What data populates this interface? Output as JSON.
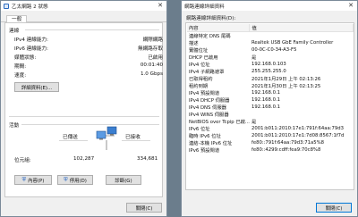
{
  "status_window": {
    "title": "乙太網路 2 狀態",
    "tab": "一般",
    "connection": {
      "heading": "連線",
      "rows": [
        {
          "label": "IPv4 連線能力:",
          "value": "網際網路"
        },
        {
          "label": "IPv6 連線能力:",
          "value": "無網路存取"
        },
        {
          "label": "媒體狀態:",
          "value": "已啟用"
        },
        {
          "label": "期間:",
          "value": "00:01:40"
        },
        {
          "label": "速度:",
          "value": "1.0 Gbps"
        }
      ],
      "details_button": "詳細資料(E)..."
    },
    "activity": {
      "heading": "活動",
      "sent_label": "已傳送",
      "received_label": "已接收",
      "bytes_label": "位元組:",
      "bytes_sent": "102,287",
      "bytes_received": "334,681"
    },
    "buttons": {
      "properties": "內容(P)",
      "disable": "停用(D)",
      "diagnose": "診斷(G)"
    },
    "close": "關閉(C)"
  },
  "details_window": {
    "title": "網路連線詳細資料",
    "subtitle": "網路連線詳細資料(D):",
    "col_property": "內容",
    "col_value": "值",
    "rows": [
      {
        "p": "連線特定 DNS 尾碼",
        "v": ""
      },
      {
        "p": "描述",
        "v": "Realtek USB GbE Family Controller"
      },
      {
        "p": "實體位址",
        "v": "00-0C-C0-34-A3-F5"
      },
      {
        "p": "DHCP 已啟用",
        "v": "是"
      },
      {
        "p": "IPv4 位址",
        "v": "192.168.0.103"
      },
      {
        "p": "IPv4 子網路遮罩",
        "v": "255.255.255.0"
      },
      {
        "p": "已取得租約",
        "v": "2021年1月29日 上午 02:13:26"
      },
      {
        "p": "租約到期",
        "v": "2021年1月30日 上午 02:13:25"
      },
      {
        "p": "IPv4 預設閘道",
        "v": "192.168.0.1"
      },
      {
        "p": "IPv4 DHCP 伺服器",
        "v": "192.168.0.1"
      },
      {
        "p": "IPv4 DNS 伺服器",
        "v": "192.168.0.1"
      },
      {
        "p": "IPv4 WINS 伺服器",
        "v": ""
      },
      {
        "p": "NetBIOS over Tcpip 已啟...",
        "v": "是"
      },
      {
        "p": "IPv6 位址",
        "v": "2001:b011:2010:17e1:791f:64aa:79d3"
      },
      {
        "p": "臨時 IPv6 位址",
        "v": "2001:b011:2010:17e1:7d08:8567:1f7d"
      },
      {
        "p": "連結-本機 IPv6 位址",
        "v": "fe80::791f:64aa:79d3:71a5%8"
      },
      {
        "p": "IPv6 預設閘道",
        "v": "fe80::4299:cdff:fea9:70c8%8"
      }
    ],
    "close": "關閉(C)"
  }
}
